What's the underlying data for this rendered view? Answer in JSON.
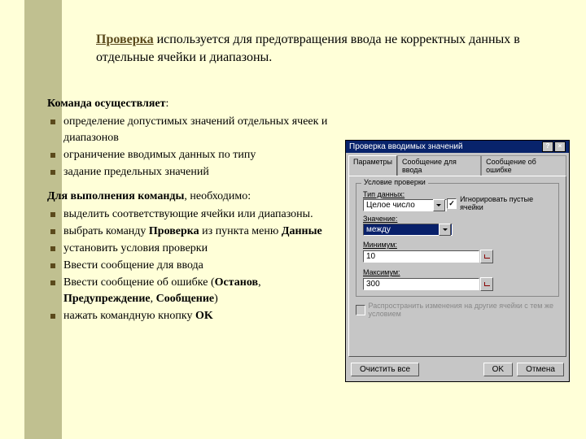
{
  "title": {
    "word": "Проверка",
    "rest": " используется для предотвращения ввода не корректных данных в отдельные ячейки и диапазоны."
  },
  "sec1": {
    "head": "Команда осуществляет",
    "items": [
      " определение допустимых значений отдельных ячеек и  диапазонов",
      "ограничение вводимых данных по типу",
      "задание предельных значений"
    ]
  },
  "sec2": {
    "head_a": "Для выполнения команды",
    "head_b": ", необходимо:",
    "items": [
      "выделить соответствующие ячейки или диапазоны.",
      "выбрать команду <b>Проверка</b> из пункта меню <b>Данные</b>",
      "установить условия проверки",
      "Ввести сообщение для ввода",
      "Ввести сообщение об ошибке (<b>Останов</b>, <b>Предупреждение</b>, <b>Сообщение</b>)",
      "нажать командную кнопку <b>OK</b>"
    ]
  },
  "dlg": {
    "title": "Проверка вводимых значений",
    "tabs": [
      "Параметры",
      "Сообщение для ввода",
      "Сообщение об ошибке"
    ],
    "group": "Условие проверки",
    "lbl_data": "Тип данных:",
    "val_data": "Целое число",
    "chk_ignore": "Игнорировать пустые ячейки",
    "lbl_cond": "Значение:",
    "val_cond": "между",
    "lbl_min": "Минимум:",
    "val_min": "10",
    "lbl_max": "Максимум:",
    "val_max": "300",
    "chk_spread": "Распространить изменения на другие ячейки с тем же условием",
    "btn_clear": "Очистить все",
    "btn_ok": "OK",
    "btn_cancel": "Отмена"
  }
}
